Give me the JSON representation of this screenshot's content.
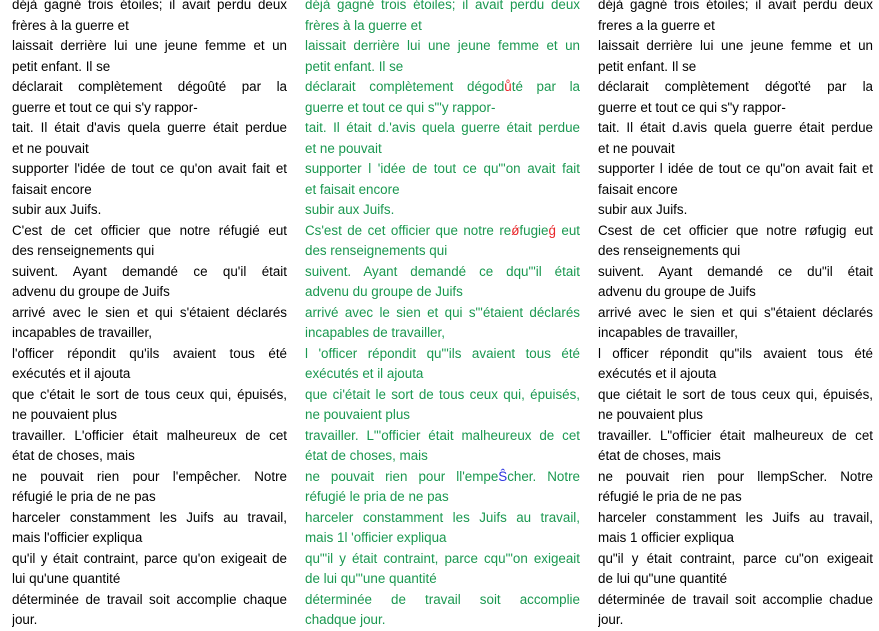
{
  "colors": {
    "green": "#1a9850",
    "red": "#e8262a",
    "blue": "#2b34e0",
    "black": "#000000"
  },
  "col1": [
    {
      "t": "déjà gagné trois étoiles; il avait perdu deux",
      "j": true
    },
    {
      "t": "frères à la guerre et",
      "j": false
    },
    {
      "t": "laissait derrière lui une jeune femme et un",
      "j": true
    },
    {
      "t": "petit enfant. Il se",
      "j": false
    },
    {
      "t": "déclarait complètement dégoûté par la",
      "j": true
    },
    {
      "t": "guerre et tout ce qui s'y rappor-",
      "j": false
    },
    {
      "t": "tait. Il était d'avis quela guerre était perdue",
      "j": true
    },
    {
      "t": "et ne pouvait",
      "j": false
    },
    {
      "t": "supporter l'idée de tout ce qu'on avait fait et",
      "j": true
    },
    {
      "t": "faisait encore",
      "j": false
    },
    {
      "t": "subir aux Juifs.",
      "j": false
    },
    {
      "t": "C'est de cet officier que notre réfugié eut",
      "j": true
    },
    {
      "t": "des renseignements qui",
      "j": false
    },
    {
      "t": "suivent. Ayant demandé ce qu'il était",
      "j": true
    },
    {
      "t": "advenu du groupe de Juifs",
      "j": false
    },
    {
      "t": "arrivé avec le sien et qui s'étaient déclarés",
      "j": true
    },
    {
      "t": "incapables de travailler,",
      "j": false
    },
    {
      "t": "l'officer répondit qu'ils avaient tous été",
      "j": true
    },
    {
      "t": "exécutés et il ajouta",
      "j": false
    },
    {
      "t": "que c'était le sort de tous ceux qui, épuisés,",
      "j": true
    },
    {
      "t": "ne pouvaient plus",
      "j": false
    },
    {
      "t": "travailler. L'officier était malheureux de cet",
      "j": true
    },
    {
      "t": "état de choses, mais",
      "j": false
    },
    {
      "t": "ne pouvait rien pour l'empêcher. Notre",
      "j": true
    },
    {
      "t": "réfugié le pria de ne pas",
      "j": false
    },
    {
      "t": "harceler constamment les Juifs au travail,",
      "j": true
    },
    {
      "t": "mais l'officier expliqua",
      "j": false
    },
    {
      "t": "qu'il y était contraint, parce qu'on exigeait de",
      "j": true
    },
    {
      "t": "lui qu'une quantité",
      "j": false
    },
    {
      "t": "déterminée de travail soit accomplie chaque",
      "j": true
    },
    {
      "t": "jour.",
      "j": false
    }
  ],
  "col2": [
    {
      "t": "déjà gagné trois étoiles; il avait perdu deux",
      "j": true
    },
    {
      "t": "frères à la guerre et",
      "j": false
    },
    {
      "t": "laissait derrière lui une jeune femme et un",
      "j": true
    },
    {
      "t": "petit enfant. Il se",
      "j": false
    },
    {
      "t": "déclarait complètement dégodůté par la",
      "j": true
    },
    {
      "t": "guerre et tout ce qui s\"'y rappor-",
      "j": false
    },
    {
      "t": "tait. Il était d.'avis quela guerre était perdue",
      "j": true
    },
    {
      "t": "et ne pouvait",
      "j": false
    },
    {
      "t": "supporter l 'idée de tout ce qu\"'on avait fait",
      "j": true
    },
    {
      "t": "et faisait encore",
      "j": false
    },
    {
      "t": "subir aux Juifs.",
      "j": false
    },
    {
      "t": "Cs'est de cet officier que notre reǿfugieǵ eut",
      "j": true
    },
    {
      "t": "des renseignements qui",
      "j": false
    },
    {
      "t": "suivent. Ayant demandé ce dqu\"'il était",
      "j": true
    },
    {
      "t": "advenu du groupe de Juifs",
      "j": false
    },
    {
      "t": "arrivé avec le sien et qui s\"'étaient déclarés",
      "j": true
    },
    {
      "t": "incapables de travailler,",
      "j": false
    },
    {
      "t": "l 'officer répondit qu\"'ils avaient tous été",
      "j": true
    },
    {
      "t": "exécutés et il ajouta",
      "j": false
    },
    {
      "t": "que ci'était le sort de tous ceux qui, épuisés,",
      "j": true
    },
    {
      "t": "ne pouvaient plus",
      "j": false
    },
    {
      "t": "travailler. L\"'officier était malheureux de cet",
      "j": true
    },
    {
      "t": "état de choses, mais",
      "j": false
    },
    {
      "t": "ne pouvait rien pour ll'empeŜcher. Notre",
      "j": true
    },
    {
      "t": "réfugié le pria de ne pas",
      "j": false
    },
    {
      "t": "harceler constamment les Juifs au travail,",
      "j": true
    },
    {
      "t": "mais 1l 'officier expliqua",
      "j": false
    },
    {
      "t": "qu\"'il y était contraint, parce cqu\"'on exigeait",
      "j": true
    },
    {
      "t": "de lui qu\"'une quantité",
      "j": false
    },
    {
      "t": "déterminée de travail soit accomplie",
      "j": true
    },
    {
      "t": "chadque jour.",
      "j": false
    }
  ],
  "col3": [
    {
      "t": "déjà gagné trois étoiles; il avait perdu deux",
      "j": true
    },
    {
      "t": "freres a la guerre et",
      "j": false
    },
    {
      "t": "laissait derrière lui une jeune femme et un",
      "j": true
    },
    {
      "t": "petit enfant. Il se",
      "j": false
    },
    {
      "t": "déclarait complètement dégoťté par la",
      "j": true
    },
    {
      "t": "guerre et tout ce qui s\"y rappor-",
      "j": false
    },
    {
      "t": "tait. Il était d.avis quela guerre était perdue",
      "j": true
    },
    {
      "t": "et ne pouvait",
      "j": false
    },
    {
      "t": "supporter l idée de tout ce qu\"on avait fait et",
      "j": true
    },
    {
      "t": "faisait encore",
      "j": false
    },
    {
      "t": "subir aux Juifs.",
      "j": false
    },
    {
      "t": "Csest de cet officier que notre røfugig eut",
      "j": true
    },
    {
      "t": "des renseignements qui",
      "j": false
    },
    {
      "t": "suivent. Ayant demandé ce du\"il était",
      "j": true
    },
    {
      "t": "advenu du groupe de Juifs",
      "j": false
    },
    {
      "t": "arrivé avec le sien et qui s\"étaient déclarés",
      "j": true
    },
    {
      "t": "incapables de travailler,",
      "j": false
    },
    {
      "t": "l officer répondit qu\"ils avaient tous été",
      "j": true
    },
    {
      "t": "exécutés et il ajouta",
      "j": false
    },
    {
      "t": "que ciétait le sort de tous ceux qui, épuisés,",
      "j": true
    },
    {
      "t": "ne pouvaient plus",
      "j": false
    },
    {
      "t": "travailler. L\"officier était malheureux de cet",
      "j": true
    },
    {
      "t": "état de choses, mais",
      "j": false
    },
    {
      "t": "ne pouvait rien pour llempScher. Notre",
      "j": true
    },
    {
      "t": "réfugié le pria de ne pas",
      "j": false
    },
    {
      "t": "harceler constamment les Juifs au travail,",
      "j": true
    },
    {
      "t": "mais 1 officier expliqua",
      "j": false
    },
    {
      "t": "qu\"il y était contraint, parce cu\"on exigeait",
      "j": true
    },
    {
      "t": "de lui qu\"une quantité",
      "j": false
    },
    {
      "t": "déterminée de travail soit accomplie chadue",
      "j": true
    },
    {
      "t": "jour.",
      "j": false
    }
  ]
}
